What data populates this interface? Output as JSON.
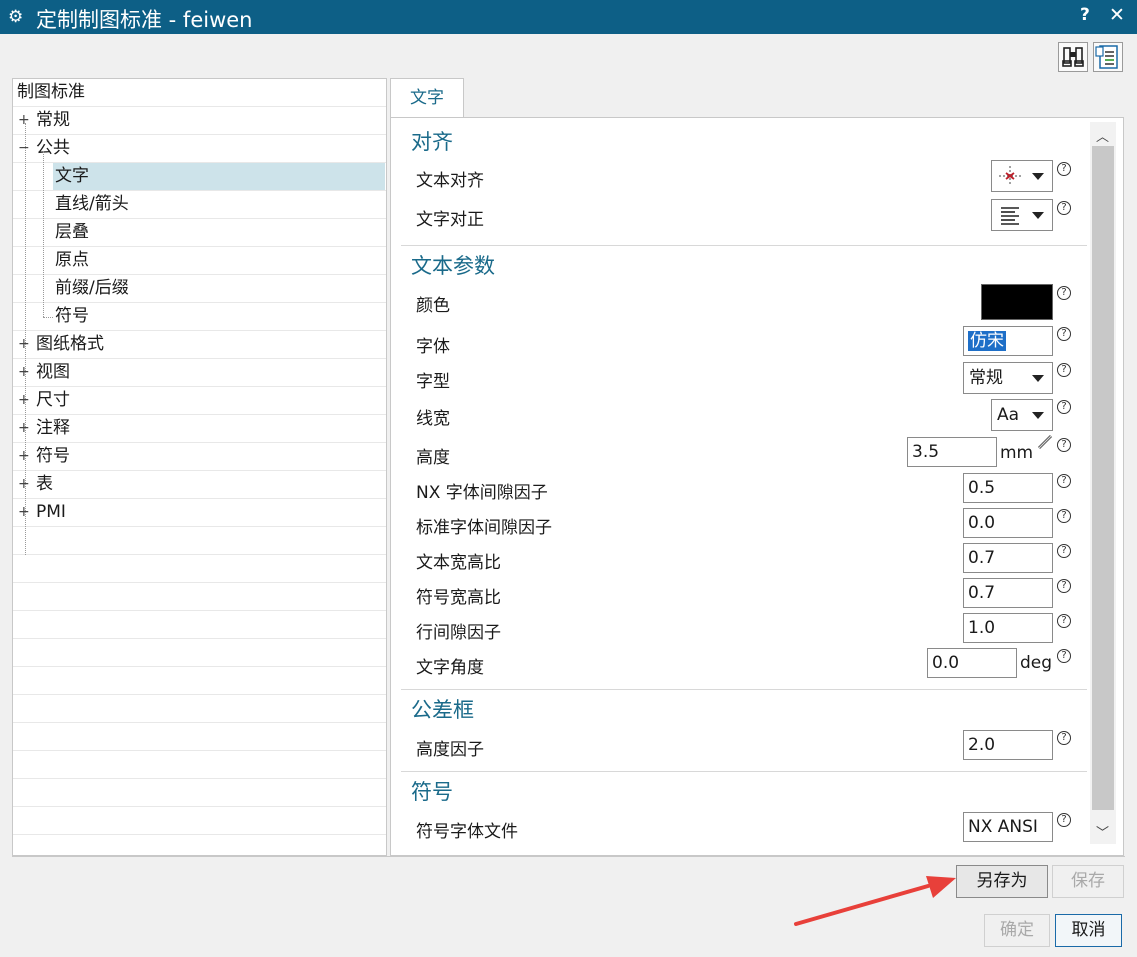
{
  "window": {
    "title": "定制制图标准 - feiwen",
    "help_label": "?",
    "close_label": "✕"
  },
  "toolbar": {
    "find_icon": "binoculars-icon",
    "settings_icon": "customize-list-icon"
  },
  "tree": {
    "root": "制图标准",
    "items": [
      {
        "label": "常规",
        "expander": "+"
      },
      {
        "label": "公共",
        "expander": "−"
      },
      {
        "label": "文字",
        "expander": ""
      },
      {
        "label": "直线/箭头",
        "expander": ""
      },
      {
        "label": "层叠",
        "expander": ""
      },
      {
        "label": "原点",
        "expander": ""
      },
      {
        "label": "前缀/后缀",
        "expander": ""
      },
      {
        "label": "符号",
        "expander": ""
      },
      {
        "label": "图纸格式",
        "expander": "+"
      },
      {
        "label": "视图",
        "expander": "+"
      },
      {
        "label": "尺寸",
        "expander": "+"
      },
      {
        "label": "注释",
        "expander": "+"
      },
      {
        "label": "符号",
        "expander": "+"
      },
      {
        "label": "表",
        "expander": "+"
      },
      {
        "label": "PMI",
        "expander": "+"
      }
    ]
  },
  "tab": {
    "label": "文字"
  },
  "sections": {
    "align": {
      "title": "对齐",
      "text_align": "文本对齐",
      "text_justify": "文字对正"
    },
    "text_params": {
      "title": "文本参数",
      "color_label": "颜色",
      "color_value": "#000000",
      "font_label": "字体",
      "font_value": "仿宋",
      "style_label": "字型",
      "style_value": "常规",
      "width_label": "线宽",
      "width_value": "Aa",
      "height_label": "高度",
      "height_value": "3.5",
      "height_unit": "mm",
      "nx_gap_label": "NX 字体间隙因子",
      "nx_gap_value": "0.5",
      "std_gap_label": "标准字体间隙因子",
      "std_gap_value": "0.0",
      "text_ratio_label": "文本宽高比",
      "text_ratio_value": "0.7",
      "sym_ratio_label": "符号宽高比",
      "sym_ratio_value": "0.7",
      "line_gap_label": "行间隙因子",
      "line_gap_value": "1.0",
      "angle_label": "文字角度",
      "angle_value": "0.0",
      "angle_unit": "deg"
    },
    "tolerance": {
      "title": "公差框",
      "height_factor_label": "高度因子",
      "height_factor_value": "2.0"
    },
    "symbol": {
      "title": "符号",
      "font_file_label": "符号字体文件",
      "font_file_value": "NX ANSI"
    }
  },
  "help_mark": "?",
  "buttons": {
    "save_as": "另存为",
    "save": "保存",
    "ok": "确定",
    "cancel": "取消"
  },
  "annotation_color": "#e8403a"
}
